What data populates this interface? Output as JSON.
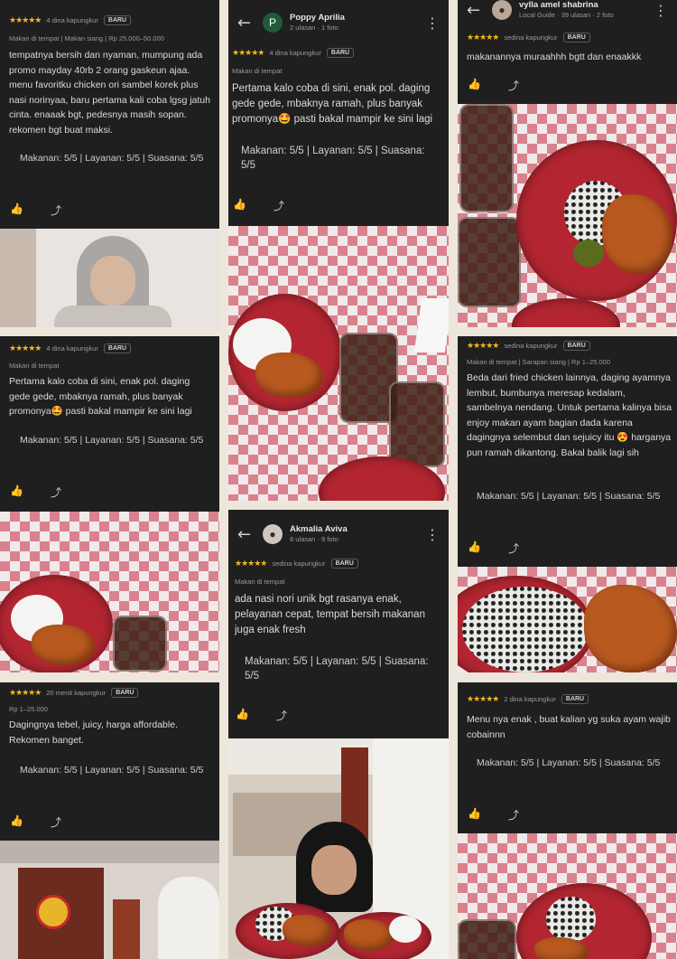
{
  "reviews": {
    "r1": {
      "stars": "★★★★★",
      "time": "4 dina kapungkur",
      "badge": "BARU",
      "sub": "Makan di tempat  |  Makan siang  |  Rp 25.000–50.000",
      "text": "tempatnya bersih dan nyaman, mumpung ada promo mayday 40rb 2 orang gaskeun ajaa. menu favoritku chicken ori sambel korek plus nasi norinyaa, baru pertama kali coba lgsg jatuh cinta. enaaak bgt, pedesnya masih sopan. rekomen bgt buat maksi.",
      "scores": "Makanan: 5/5  |  Layanan: 5/5  |  Suasana: 5/5"
    },
    "r2": {
      "name": "Poppy Aprilia",
      "meta": "2 ulasan · 1 foto",
      "initial": "P",
      "stars": "★★★★★",
      "time": "4 dina kapungkur",
      "badge": "BARU",
      "sub": "Makan di tempat",
      "text": "Pertama kalo coba di sini, enak pol. daging gede gede, mbaknya ramah, plus banyak promonya🤩 pasti bakal mampir ke sini lagi",
      "scores": "Makanan: 5/5  |  Layanan: 5/5  |  Suasana: 5/5"
    },
    "r3": {
      "name": "vylla amel shabrina",
      "meta": "Local Guide · 39 ulasan · 2 foto",
      "stars": "★★★★★",
      "time": "sedina kapungkur",
      "badge": "BARU",
      "text": "makanannya muraahhh bgtt dan enaakkk"
    },
    "r4": {
      "stars": "★★★★★",
      "time": "4 dina kapungkur",
      "badge": "BARU",
      "sub": "Makan di tempat",
      "text": "Pertama kalo coba di sini, enak pol. daging gede gede, mbaknya ramah, plus banyak promonya🤩 pasti bakal mampir ke sini lagi",
      "scores": "Makanan: 5/5  |  Layanan: 5/5  |  Suasana: 5/5"
    },
    "r5": {
      "stars": "★★★★★",
      "time": "sedina kapungkur",
      "badge": "BARU",
      "sub": "Makan di tempat  |  Sarapan siang  |  Rp 1–25.000",
      "text": "Beda dari fried chicken lainnya, daging ayamnya lembut, bumbunya meresap kedalam, sambelnya nendang. Untuk pertama kalinya bisa enjoy makan ayam bagian dada karena dagingnya selembut dan sejuicy itu 😍 harganya pun ramah dikantong. Bakal balik lagi sih",
      "scores": "Makanan: 5/5  |  Layanan: 5/5  |  Suasana: 5/5"
    },
    "r6": {
      "name": "Akmalia Aviva",
      "meta": "8 ulasan · 9 foto",
      "stars": "★★★★★",
      "time": "sedina kapungkur",
      "badge": "BARU",
      "sub": "Makan di tempat",
      "text": "ada nasi nori unik bgt rasanya enak, pelayanan cepat, tempat bersih makanan juga enak fresh",
      "scores": "Makanan: 5/5  |  Layanan: 5/5  |  Suasana: 5/5"
    },
    "r7": {
      "stars": "★★★★★",
      "time": "20 menit kapungkur",
      "badge": "BARU",
      "sub": "Rp 1–25.000",
      "text": "Dagingnya tebel, juicy, harga affordable. Rekomen banget.",
      "scores": "Makanan: 5/5  |  Layanan: 5/5  |  Suasana: 5/5"
    },
    "r8": {
      "stars": "★★★★★",
      "time": "2 dina kapungkur",
      "badge": "BARU",
      "text": "Menu nya enak , buat kalian yg suka ayam wajib cobainnn",
      "scores": "Makanan: 5/5  |  Layanan: 5/5  |  Suasana: 5/5"
    }
  },
  "icons": {
    "back": "←",
    "more": "⋮",
    "like": "👍",
    "share": "⤴"
  },
  "colors": {
    "card_bg": "#1f1f1f",
    "page_bg": "#ede6da",
    "star": "#f3b81a",
    "plate": "#b32631"
  }
}
